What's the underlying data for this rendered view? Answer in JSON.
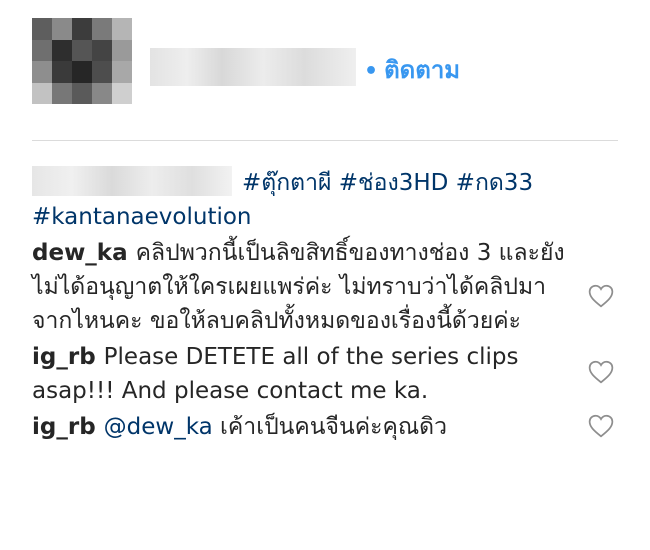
{
  "header": {
    "follow_dot": "•",
    "follow_label": "ติดตาม",
    "avatar_pixels": [
      "#5e5e5e",
      "#8a8a8a",
      "#3c3c3c",
      "#7a7a7a",
      "#b5b5b5",
      "#6f6f6f",
      "#2e2e2e",
      "#555555",
      "#444444",
      "#9a9a9a",
      "#8e8e8e",
      "#3a3a3a",
      "#262626",
      "#4d4d4d",
      "#a8a8a8",
      "#c2c2c2",
      "#777777",
      "#5a5a5a",
      "#888888",
      "#cfcfcf"
    ]
  },
  "caption": {
    "tags": [
      "#ตุ๊กตาผี",
      "#ช่อง3HD",
      "#กด33",
      "#kantanaevolution"
    ]
  },
  "comments": [
    {
      "username": "dew_ka",
      "text": "คลิปพวกนี้เป็นลิขสิทธิ์ของทางช่อง 3 และยังไม่ได้อนุญาตให้ใครเผยแพร่ค่ะ ไม่ทราบว่าได้คลิปมาจากไหนคะ ขอให้ลบคลิปทั้งหมดของเรื่องนี้ด้วยค่ะ"
    },
    {
      "username": "ig_rb",
      "text": "Please DETETE all of the series clips asap!!! And please contact me ka."
    },
    {
      "username": "ig_rb",
      "mention": "@dew_ka",
      "text": "เค้าเป็นคนจีนค่ะคุณดิว"
    }
  ],
  "colors": {
    "link": "#3897f0",
    "hashtag": "#003569",
    "text": "#262626",
    "divider": "#dbdbdb"
  }
}
